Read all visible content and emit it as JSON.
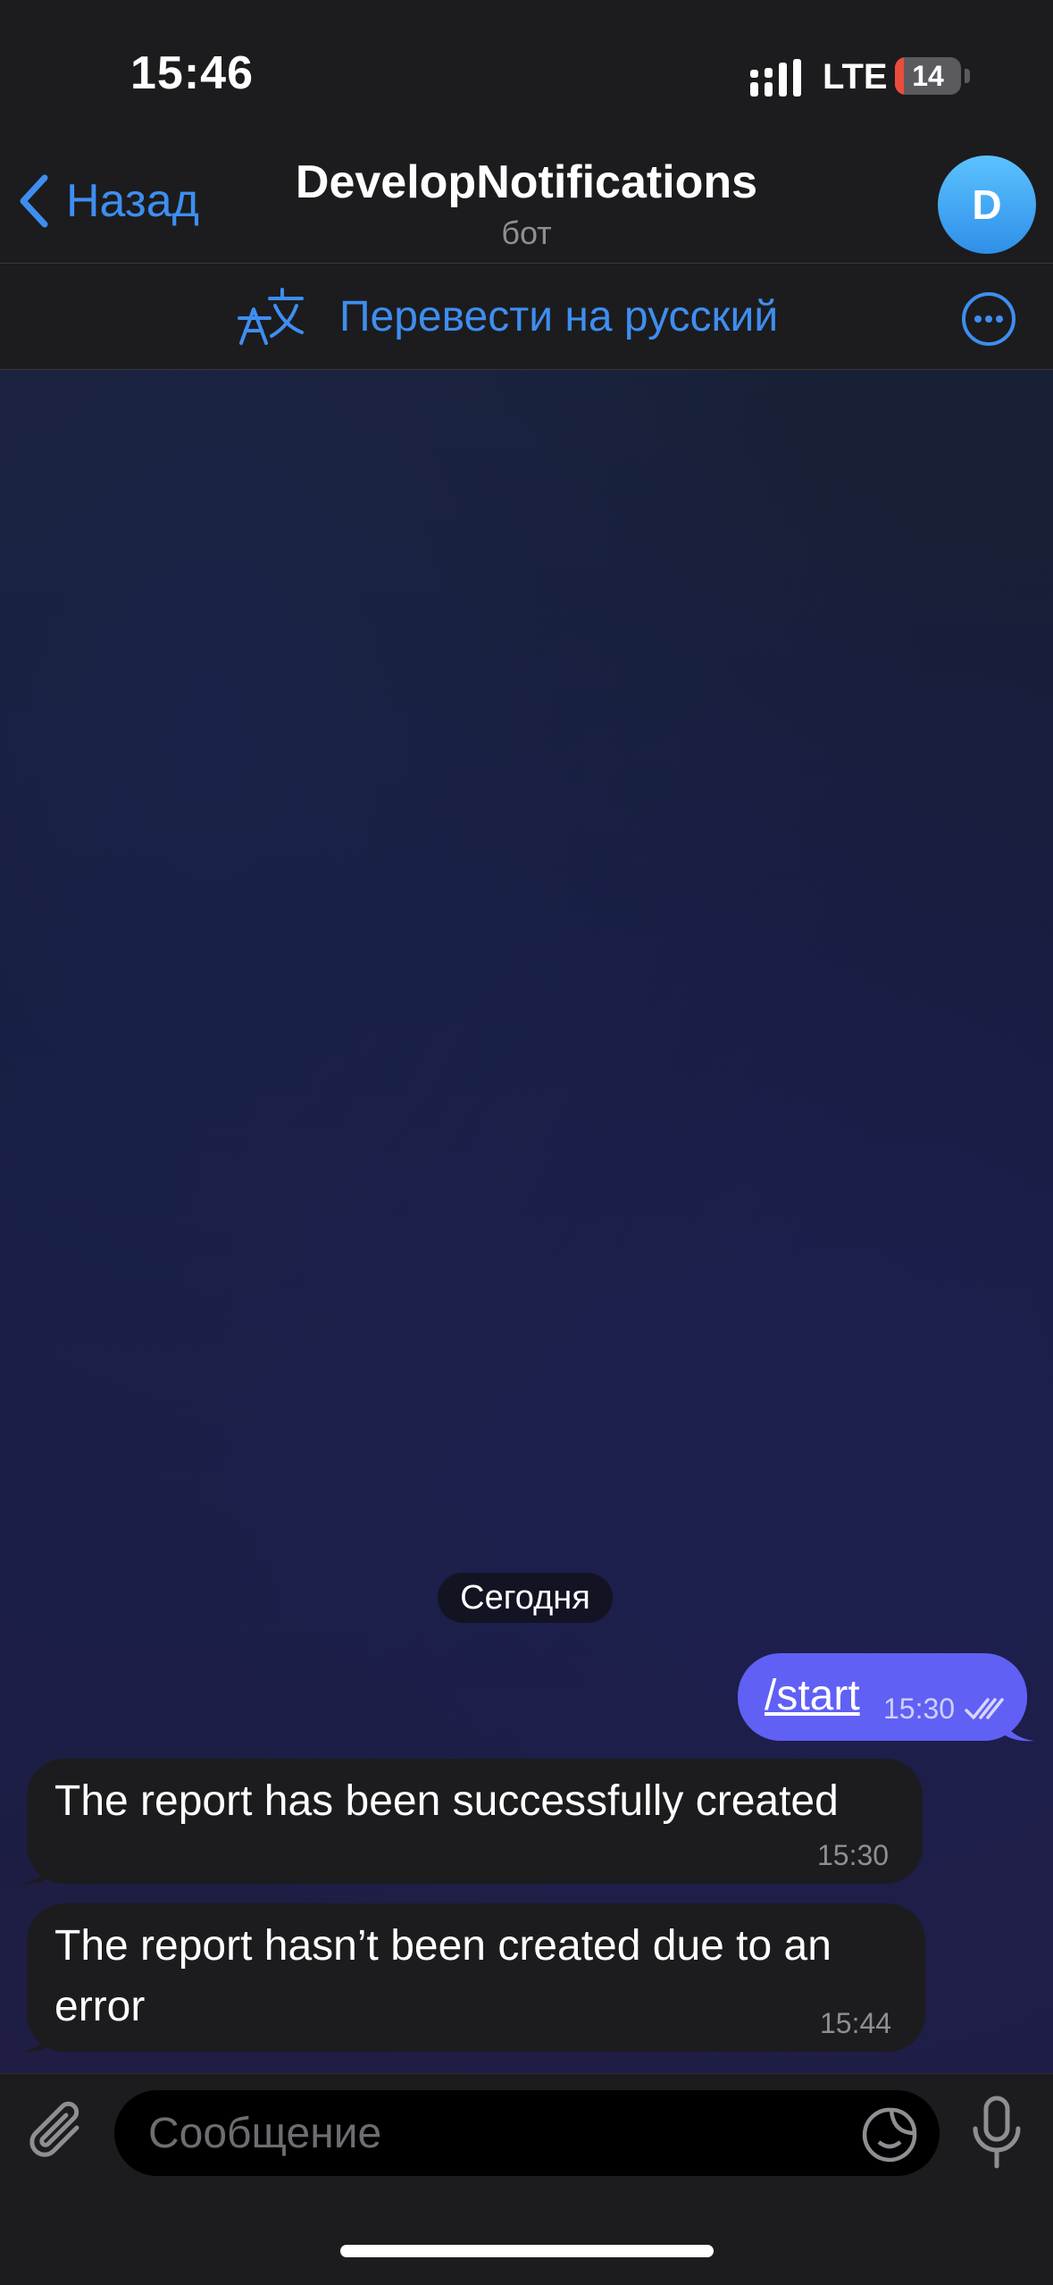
{
  "status_bar": {
    "time": "15:46",
    "network": "LTE",
    "battery_level": "14",
    "battery_color": "#eb4d3d"
  },
  "header": {
    "back_label": "Назад",
    "title": "DevelopNotifications",
    "subtitle": "бот",
    "avatar_letter": "D"
  },
  "translate_bar": {
    "label": "Перевести на русский"
  },
  "chat": {
    "date_separator": "Сегодня",
    "outgoing": {
      "text": "/start",
      "time": "15:30",
      "status": "read"
    },
    "incoming": [
      {
        "lines": [
          "The report has been successfully created"
        ],
        "time": "15:30"
      },
      {
        "lines": [
          "The report hasn’t been created due to an",
          "error"
        ],
        "time": "15:44"
      }
    ]
  },
  "composer": {
    "placeholder": "Сообщение"
  },
  "colors": {
    "accent": "#3e8ef0",
    "outgoing_bubble": "#6060f5",
    "incoming_bubble": "#1c1c1e"
  }
}
